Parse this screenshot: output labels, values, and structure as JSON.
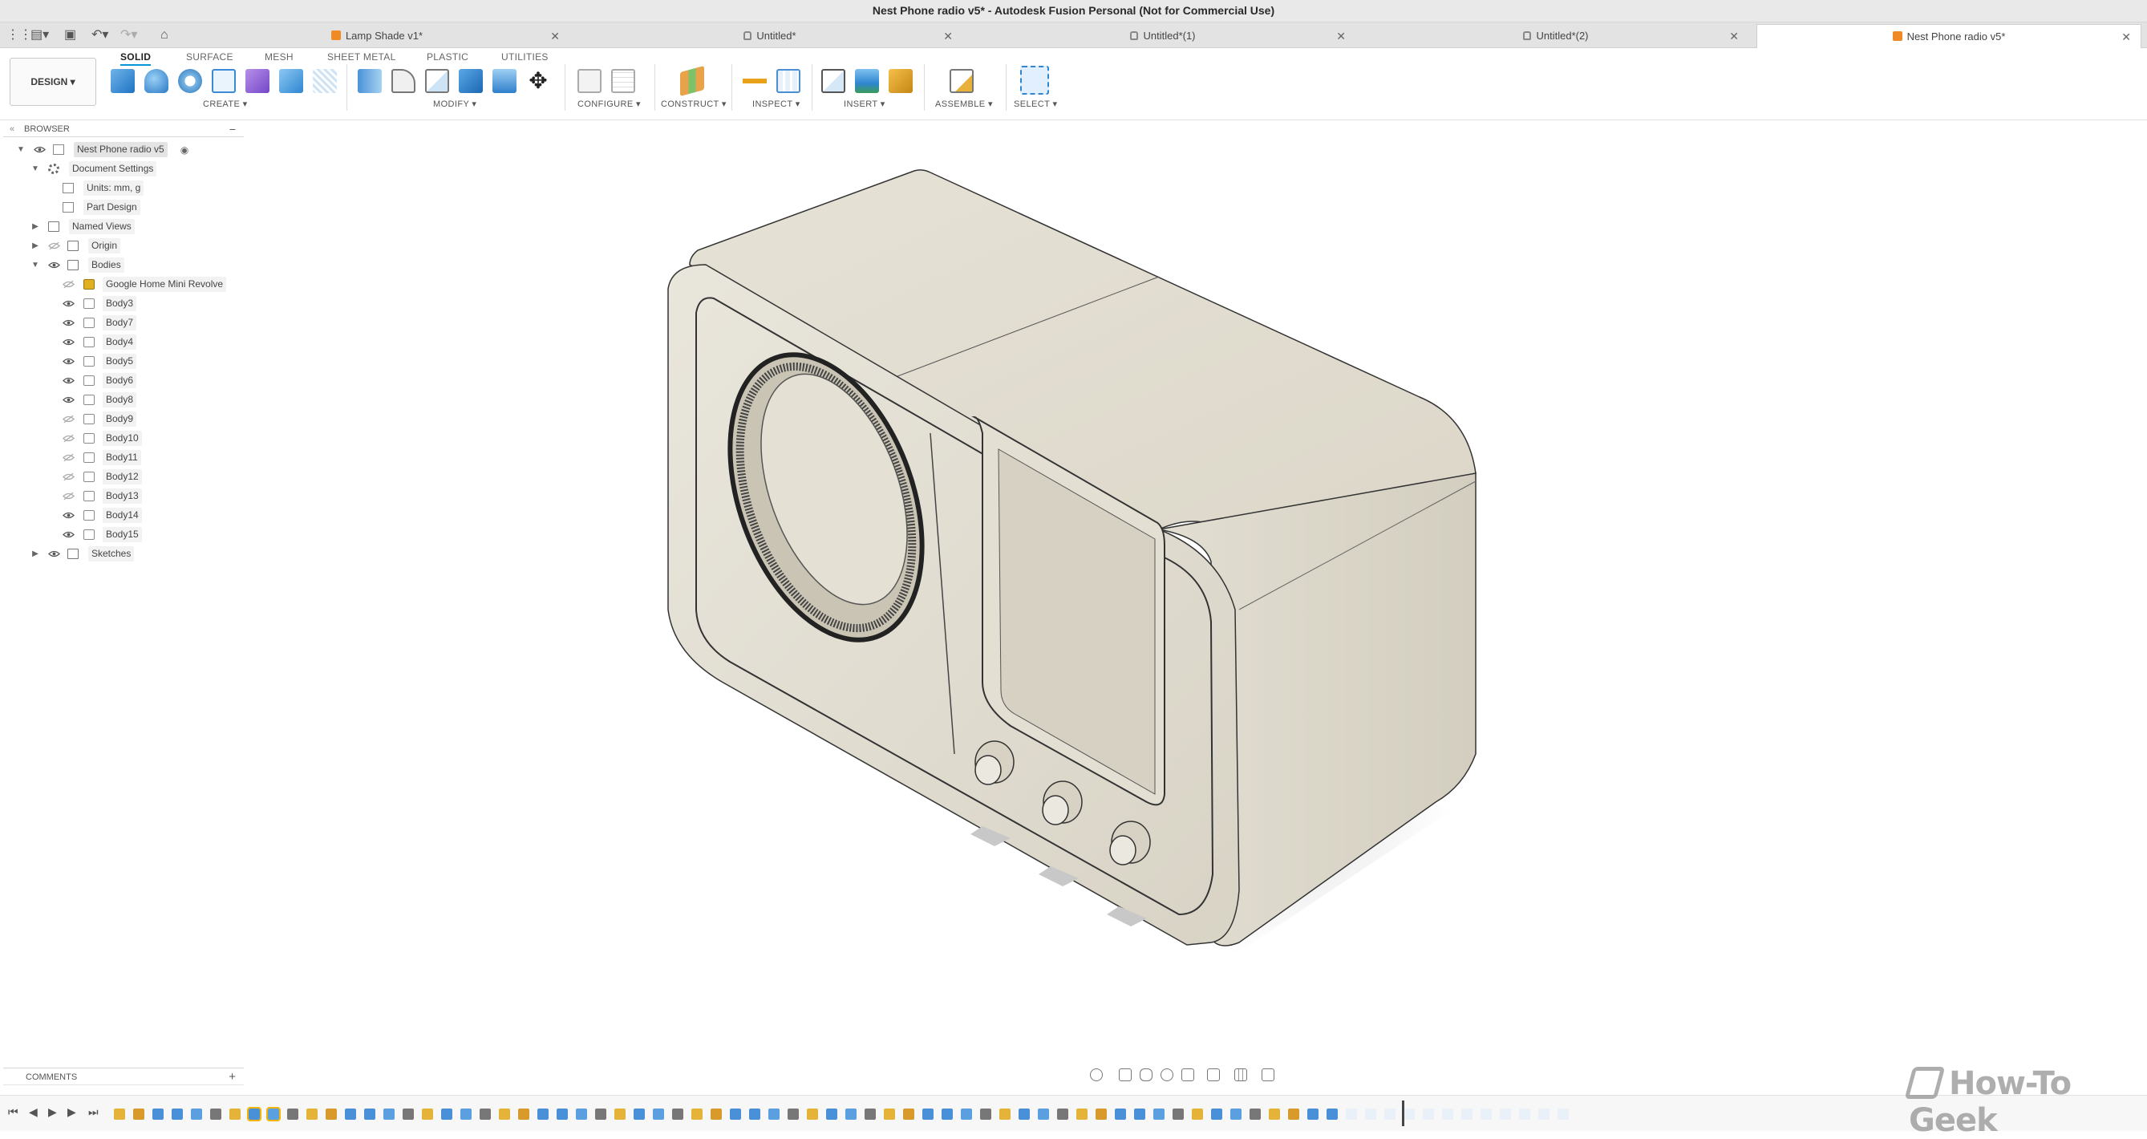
{
  "window": {
    "title": "Nest Phone radio v5* - Autodesk Fusion Personal (Not for Commercial Use)"
  },
  "tabs": [
    {
      "label": "Lamp Shade v1*",
      "icon": "cube-icon"
    },
    {
      "label": "Untitled*",
      "icon": "lock-icon"
    },
    {
      "label": "Untitled*(1)",
      "icon": "lock-icon"
    },
    {
      "label": "Untitled*(2)",
      "icon": "lock-icon"
    },
    {
      "label": "Nest Phone radio v5*",
      "icon": "cube-icon",
      "active": true
    }
  ],
  "toolbar": {
    "workspace": "DESIGN ▾",
    "ws_tabs": [
      "SOLID",
      "SURFACE",
      "MESH",
      "SHEET METAL",
      "PLASTIC",
      "UTILITIES"
    ],
    "groups": {
      "create": "CREATE ▾",
      "modify": "MODIFY ▾",
      "configure": "CONFIGURE ▾",
      "construct": "CONSTRUCT ▾",
      "inspect": "INSPECT ▾",
      "insert": "INSERT ▾",
      "assemble": "ASSEMBLE ▾",
      "select": "SELECT ▾"
    }
  },
  "browser": {
    "header": "BROWSER",
    "root": "Nest Phone radio v5",
    "document_settings": "Document Settings",
    "units": "Units: mm, g",
    "part_design": "Part Design",
    "named_views": "Named Views",
    "origin": "Origin",
    "bodies": "Bodies",
    "sketches": "Sketches",
    "body_items": [
      "Google Home Mini Revolve",
      "Body3",
      "Body7",
      "Body4",
      "Body5",
      "Body6",
      "Body8",
      "Body9",
      "Body10",
      "Body11",
      "Body12",
      "Body13",
      "Body14",
      "Body15"
    ]
  },
  "comments": {
    "label": "COMMENTS"
  },
  "watermark": "How-To Geek"
}
